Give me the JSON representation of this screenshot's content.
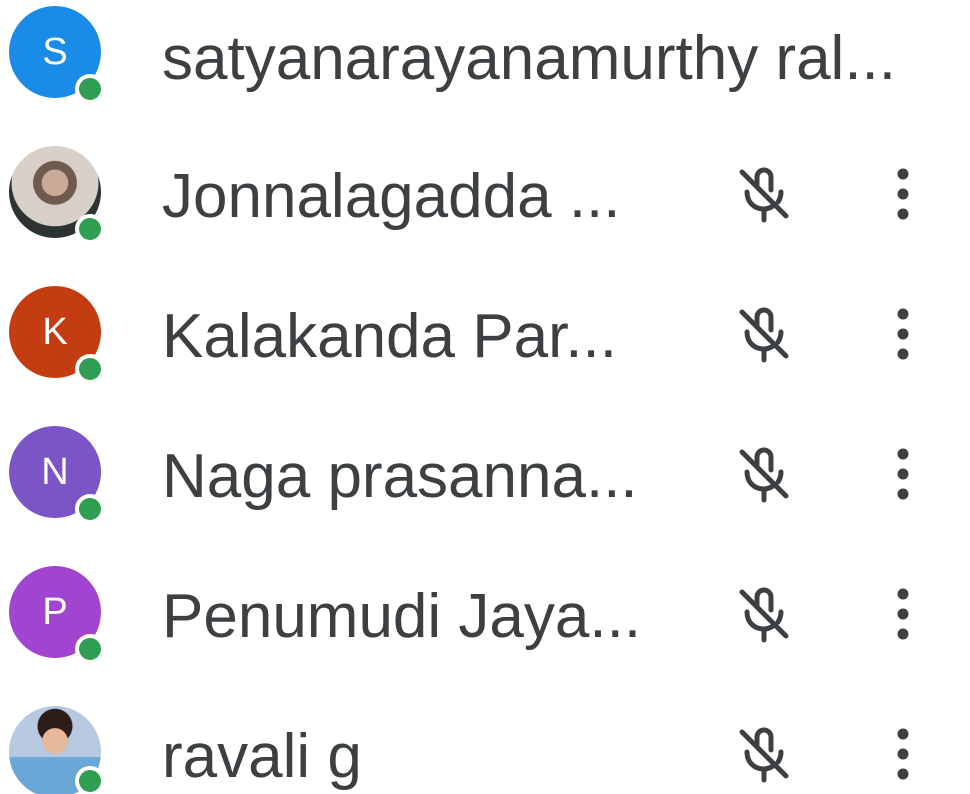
{
  "participants": [
    {
      "name": "satyanarayanamurthy ral...",
      "initial": "S",
      "avatar_color": "#1a8be6",
      "show_controls": false
    },
    {
      "name": "Jonnalagadda ...",
      "initial": "",
      "avatar_color": "#3d3b38",
      "show_controls": true
    },
    {
      "name": "Kalakanda Par...",
      "initial": "K",
      "avatar_color": "#c43d12",
      "show_controls": true
    },
    {
      "name": "Naga prasanna...",
      "initial": "N",
      "avatar_color": "#7b55c7",
      "show_controls": true
    },
    {
      "name": "Penumudi Jaya...",
      "initial": "P",
      "avatar_color": "#a145d0",
      "show_controls": true
    },
    {
      "name": "ravali g",
      "initial": "",
      "avatar_color": "#8ab4e6",
      "show_controls": true
    }
  ],
  "icons": {
    "status": "online-status-dot",
    "mic": "mic-off-icon",
    "more": "more-vert-icon"
  },
  "colors": {
    "text": "#3c4043",
    "icon": "#3c4043",
    "online": "#2f9e52"
  }
}
